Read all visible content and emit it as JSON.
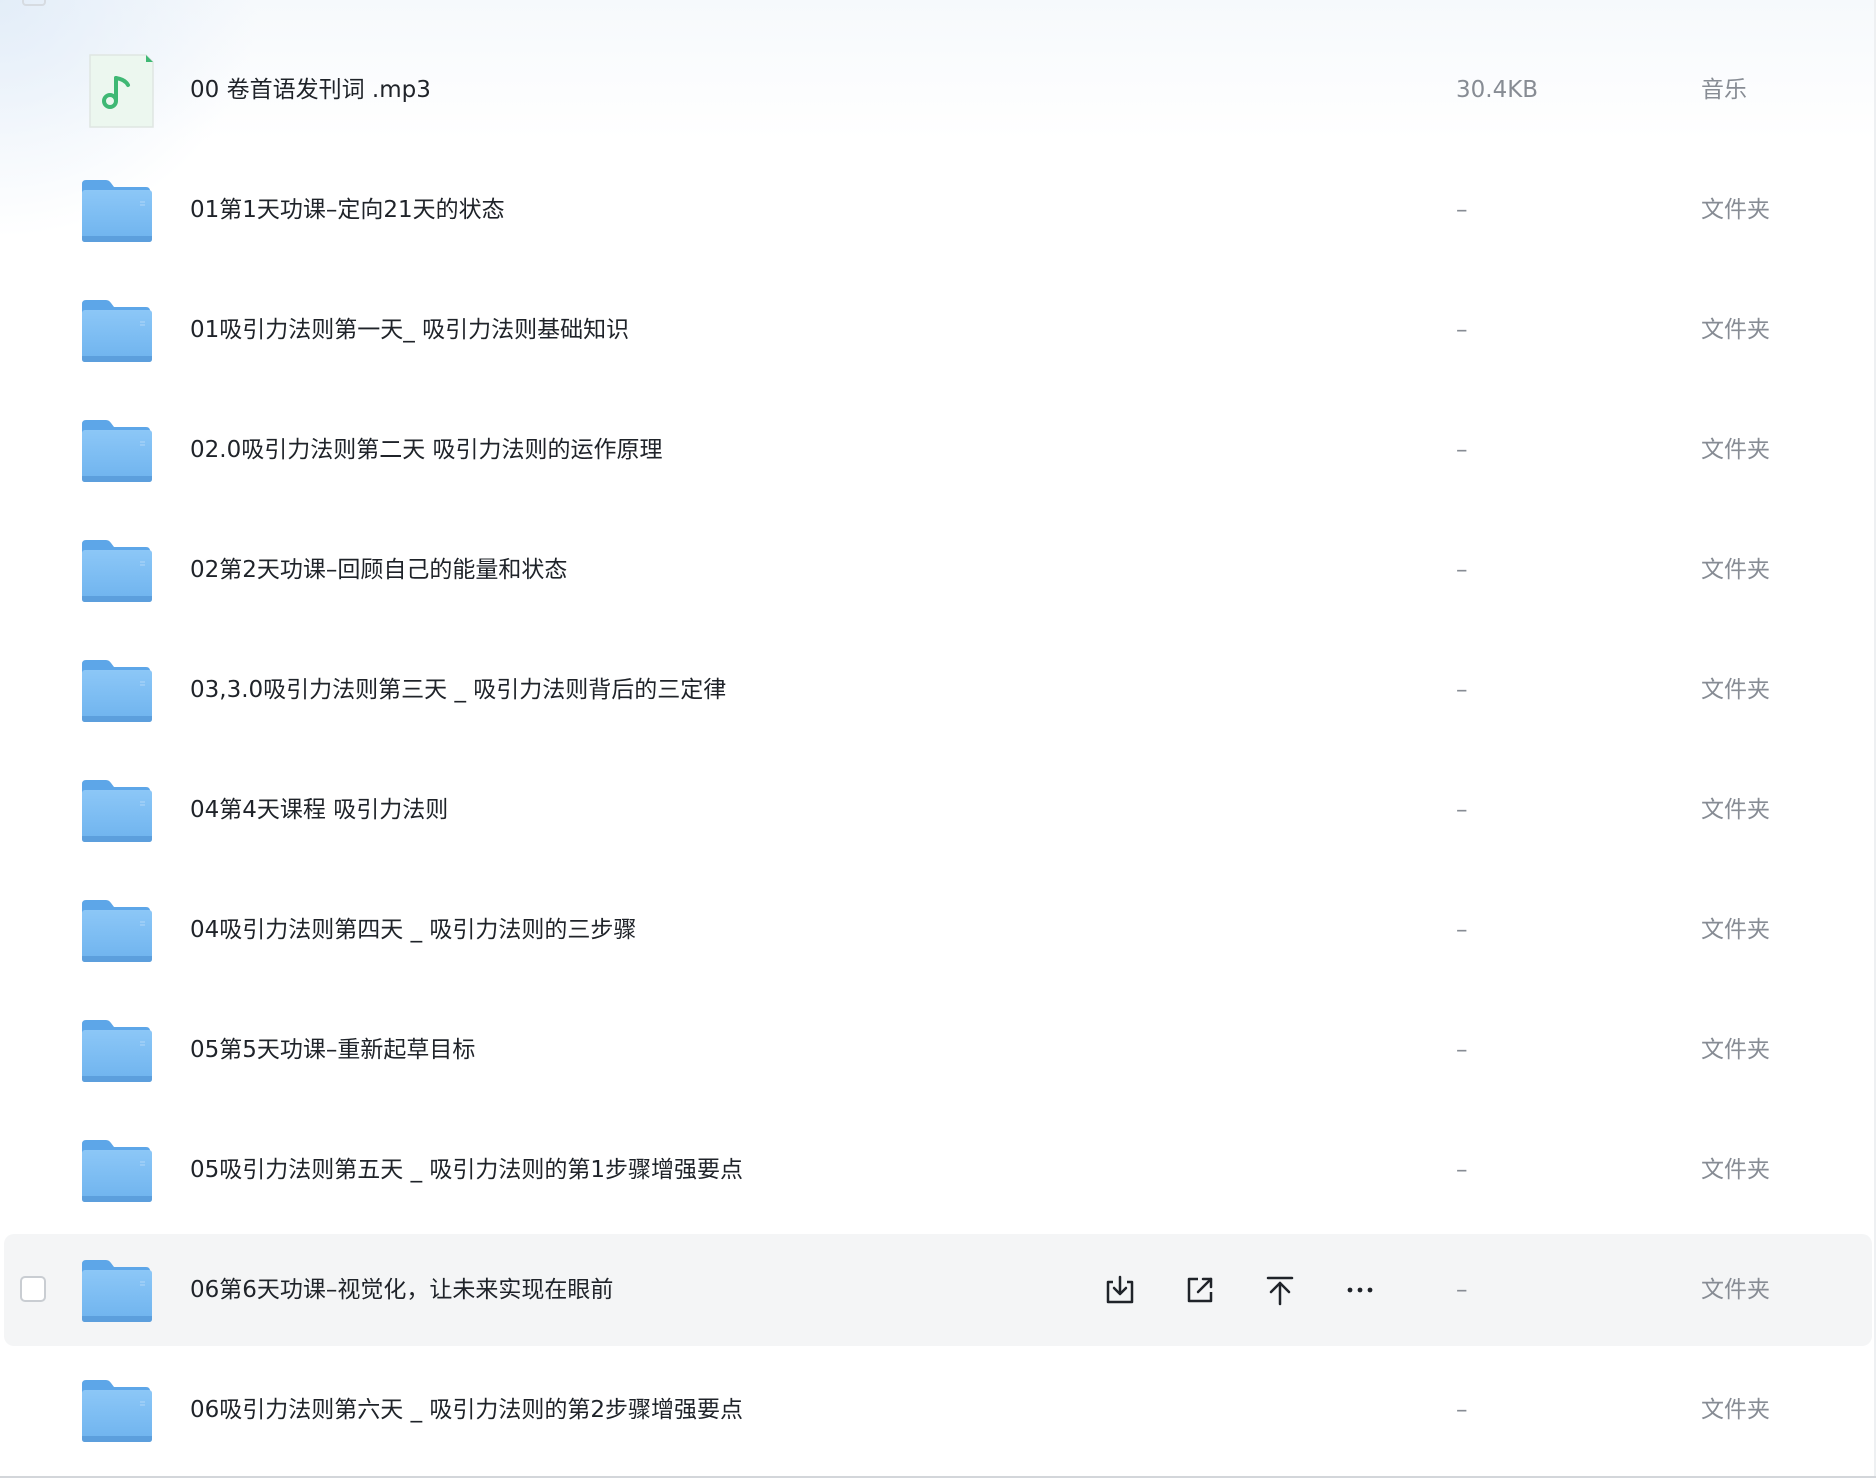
{
  "accent": "#3fb874",
  "folder_color": "#7cbcf4",
  "files": [
    {
      "name": "00 卷首语发刊词 .mp3",
      "size": "30.4KB",
      "type": "音乐",
      "icon": "music-file-icon"
    },
    {
      "name": "01第1天功课–定向21天的状态",
      "size": "–",
      "type": "文件夹",
      "icon": "folder-icon"
    },
    {
      "name": "01吸引力法则第一天_ 吸引力法则基础知识",
      "size": "–",
      "type": "文件夹",
      "icon": "folder-icon"
    },
    {
      "name": "02.0吸引力法则第二天 吸引力法则的运作原理",
      "size": "–",
      "type": "文件夹",
      "icon": "folder-icon"
    },
    {
      "name": "02第2天功课–回顾自己的能量和状态",
      "size": "–",
      "type": "文件夹",
      "icon": "folder-icon"
    },
    {
      "name": "03,3.0吸引力法则第三天 _ 吸引力法则背后的三定律",
      "size": "–",
      "type": "文件夹",
      "icon": "folder-icon"
    },
    {
      "name": "04第4天课程 吸引力法则",
      "size": "–",
      "type": "文件夹",
      "icon": "folder-icon"
    },
    {
      "name": "04吸引力法则第四天 _ 吸引力法则的三步骤",
      "size": "–",
      "type": "文件夹",
      "icon": "folder-icon"
    },
    {
      "name": "05第5天功课–重新起草目标",
      "size": "–",
      "type": "文件夹",
      "icon": "folder-icon"
    },
    {
      "name": "05吸引力法则第五天 _ 吸引力法则的第1步骤增强要点",
      "size": "–",
      "type": "文件夹",
      "icon": "folder-icon"
    },
    {
      "name": "06第6天功课–视觉化，让未来实现在眼前",
      "size": "–",
      "type": "文件夹",
      "icon": "folder-icon"
    },
    {
      "name": "06吸引力法则第六天 _ 吸引力法则的第2步骤增强要点",
      "size": "–",
      "type": "文件夹",
      "icon": "folder-icon"
    }
  ],
  "hovered_row": 10,
  "row_actions": [
    {
      "name": "download-icon"
    },
    {
      "name": "share-icon"
    },
    {
      "name": "upload-icon"
    },
    {
      "name": "more-icon"
    }
  ]
}
